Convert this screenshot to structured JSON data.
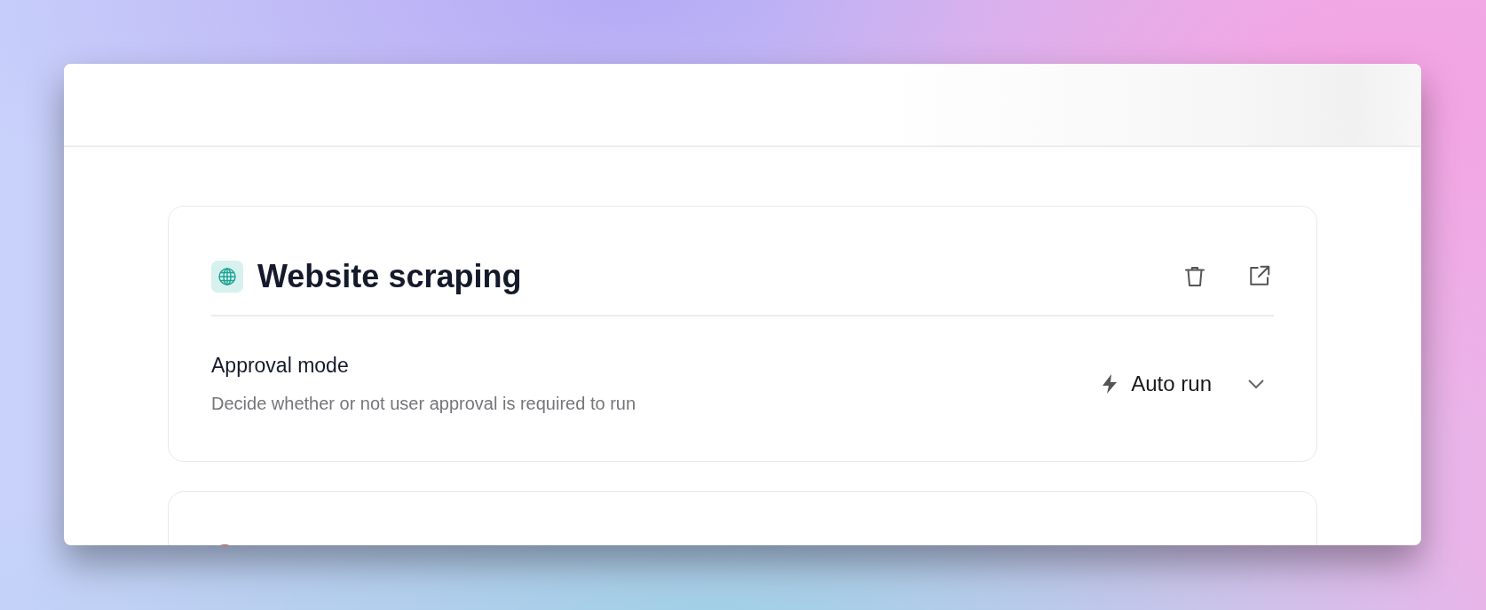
{
  "cards": [
    {
      "title": "Website scraping",
      "setting": {
        "label": "Approval mode",
        "description": "Decide whether or not user approval is required to run",
        "value": "Auto run"
      }
    }
  ]
}
